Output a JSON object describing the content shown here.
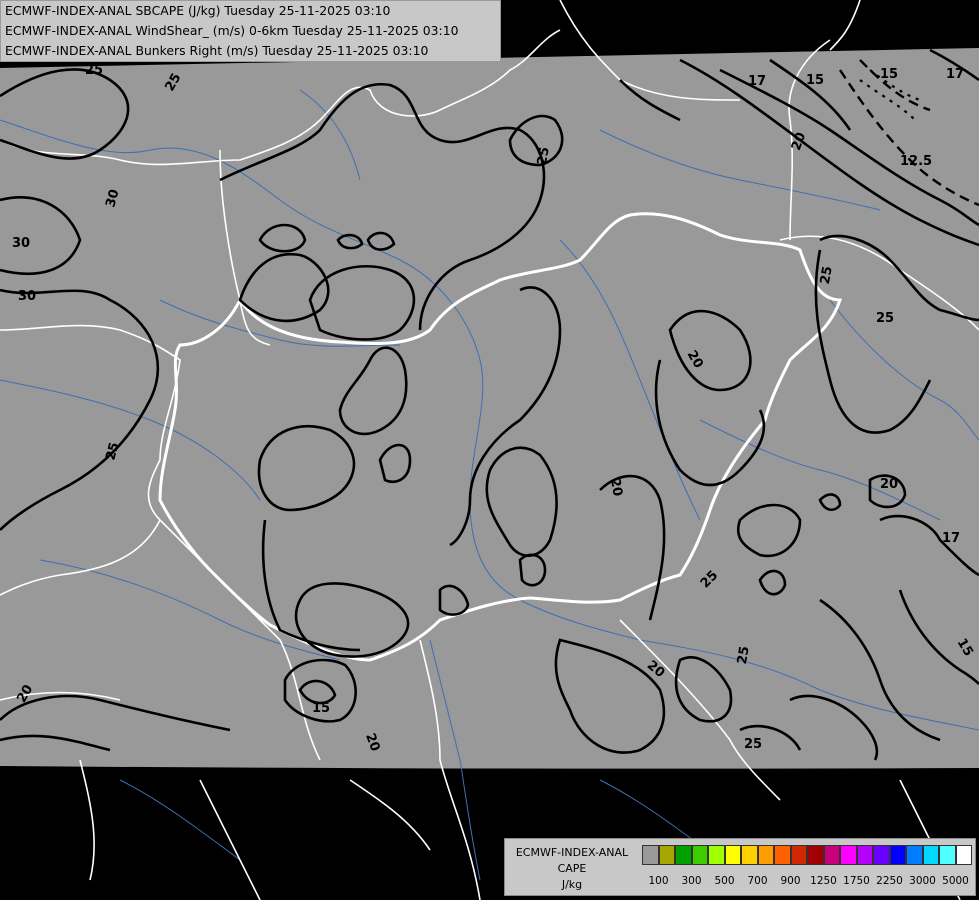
{
  "header": {
    "line1": "ECMWF-INDEX-ANAL SBCAPE (J/kg) Tuesday 25-11-2025 03:10",
    "line2": "ECMWF-INDEX-ANAL WindShear_ (m/s) 0-6km Tuesday 25-11-2025 03:10",
    "line3": "ECMWF-INDEX-ANAL Bunkers Right (m/s) Tuesday 25-11-2025 03:10"
  },
  "legend": {
    "title1": "ECMWF-INDEX-ANAL",
    "title2": "CAPE",
    "unit": "J/kg",
    "colors": [
      "#999999",
      "#a6a600",
      "#00a000",
      "#3ccc00",
      "#a0ff00",
      "#ffff00",
      "#ffd000",
      "#ff9c00",
      "#ff6000",
      "#d02800",
      "#a00000",
      "#c8007c",
      "#ff00ff",
      "#b400ff",
      "#6a00ff",
      "#0000ff",
      "#007cff",
      "#00d8ff",
      "#50ffff",
      "#ffffff"
    ],
    "ticks": [
      "100",
      "300",
      "500",
      "700",
      "900",
      "1250",
      "1750",
      "2250",
      "3000",
      "5000"
    ]
  },
  "contour_labels": [
    {
      "text": "25",
      "name": "label-25-nw"
    },
    {
      "text": "25",
      "name": "label-25-north"
    },
    {
      "text": "25",
      "name": "label-25-poland"
    },
    {
      "text": "30",
      "name": "label-30-a"
    },
    {
      "text": "30",
      "name": "label-30-b"
    },
    {
      "text": "30",
      "name": "label-30-c"
    },
    {
      "text": "25",
      "name": "label-25-west"
    },
    {
      "text": "17",
      "name": "label-17-ne"
    },
    {
      "text": "15",
      "name": "label-15-ne"
    },
    {
      "text": "20",
      "name": "label-20-ne"
    },
    {
      "text": "15",
      "name": "label-15-ne-dashed"
    },
    {
      "text": "17",
      "name": "label-17-ne-corner"
    },
    {
      "text": "12.5",
      "name": "label-12-5"
    },
    {
      "text": "25",
      "name": "label-25-ukraine"
    },
    {
      "text": "25",
      "name": "label-25-east"
    },
    {
      "text": "20",
      "name": "label-20-hungary"
    },
    {
      "text": "20",
      "name": "label-20-center"
    },
    {
      "text": "20",
      "name": "label-20-romania"
    },
    {
      "text": "17",
      "name": "label-17-east"
    },
    {
      "text": "25",
      "name": "label-25-danube"
    },
    {
      "text": "15",
      "name": "label-15-se"
    },
    {
      "text": "20",
      "name": "label-20-serbia"
    },
    {
      "text": "25",
      "name": "label-25-south"
    },
    {
      "text": "25",
      "name": "label-25-se"
    },
    {
      "text": "15",
      "name": "label-15-sw"
    },
    {
      "text": "20",
      "name": "label-20-sw"
    },
    {
      "text": "20",
      "name": "label-20-south"
    }
  ]
}
